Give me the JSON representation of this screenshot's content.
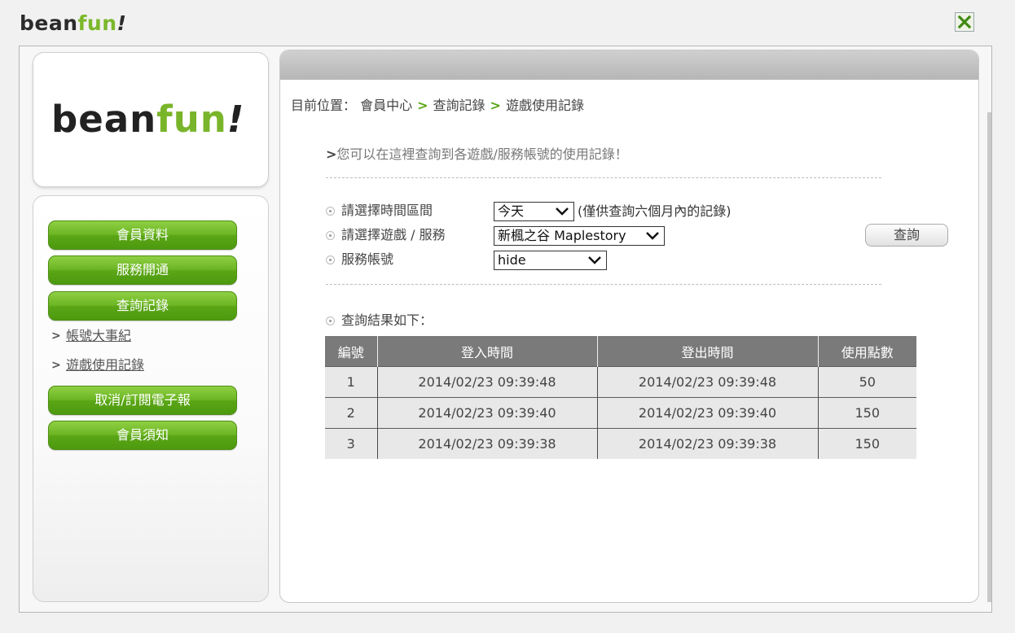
{
  "header": {
    "brand_bean": "bean",
    "brand_fun": "fun",
    "brand_bang": "!"
  },
  "sidebar": {
    "logo_bean": "bean",
    "logo_fun": "fun",
    "logo_bang": "!",
    "buttons": {
      "member_info": "會員資料",
      "service_activation": "服務開通",
      "query_records": "查詢記錄",
      "newsletter": "取消/訂閱電子報",
      "member_notice": "會員須知"
    },
    "links": {
      "account_events": "帳號大事紀",
      "game_usage": "遊戲使用記錄"
    }
  },
  "breadcrumb": {
    "prefix": "目前位置：",
    "level1": "會員中心",
    "level2": "查詢記錄",
    "level3": "遊戲使用記錄"
  },
  "intro_text": "您可以在這裡查詢到各遊戲/服務帳號的使用記錄！",
  "form": {
    "time_range_label": "請選擇時間區間",
    "time_range_value": "今天",
    "time_range_note": "(僅供查詢六個月內的記錄)",
    "game_label": "請選擇遊戲 / 服務",
    "game_value": "新楓之谷 Maplestory",
    "account_label": "服務帳號",
    "account_value": "hide",
    "query_button": "查詢"
  },
  "results": {
    "label": "查詢結果如下：",
    "columns": [
      "編號",
      "登入時間",
      "登出時間",
      "使用點數"
    ],
    "rows": [
      [
        "1",
        "2014/02/23 09:39:48",
        "2014/02/23 09:39:48",
        "50"
      ],
      [
        "2",
        "2014/02/23 09:39:40",
        "2014/02/23 09:39:40",
        "150"
      ],
      [
        "3",
        "2014/02/23 09:39:38",
        "2014/02/23 09:39:38",
        "150"
      ]
    ]
  },
  "colors": {
    "brand_green": "#79b52a",
    "button_green": "#5aa616",
    "table_header": "#7a7a7a",
    "table_cell": "#e8e8e8"
  }
}
